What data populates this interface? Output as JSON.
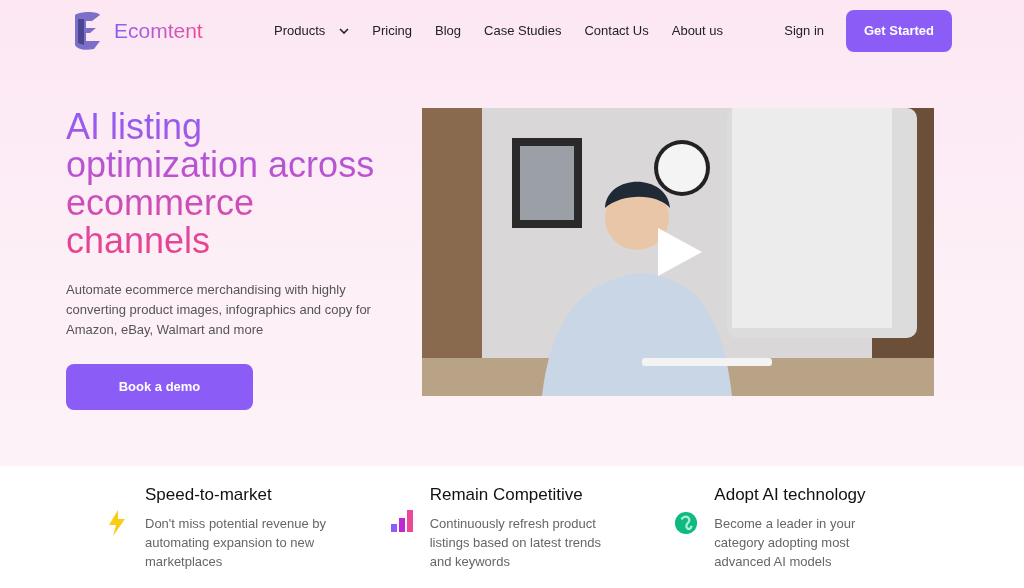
{
  "nav": {
    "brand": "Ecomtent",
    "links": [
      {
        "label": "Products",
        "dropdown": true
      },
      {
        "label": "Pricing",
        "dropdown": false
      },
      {
        "label": "Blog",
        "dropdown": false
      },
      {
        "label": "Case Studies",
        "dropdown": false
      },
      {
        "label": "Contact Us",
        "dropdown": false
      },
      {
        "label": "About us",
        "dropdown": false
      }
    ],
    "sign_in": "Sign in",
    "cta": "Get Started"
  },
  "hero": {
    "headline_lines": [
      "AI listing",
      "optimization across",
      "ecommerce",
      "channels"
    ],
    "description": "Automate ecommerce merchandising with highly converting product images, infographics and copy for Amazon, eBay, Walmart and more",
    "button": "Book a demo"
  },
  "features": [
    {
      "kind": "bolt",
      "title": "Speed-to-market",
      "text": "Don't miss potential revenue by automating expansion to new marketplaces"
    },
    {
      "kind": "bars",
      "title": "Remain Competitive",
      "text": "Continuously refresh product listings based on latest trends and keywords"
    },
    {
      "kind": "knot",
      "title": "Adopt AI technology",
      "text": "Become a leader in your category adopting most advanced AI models"
    }
  ]
}
